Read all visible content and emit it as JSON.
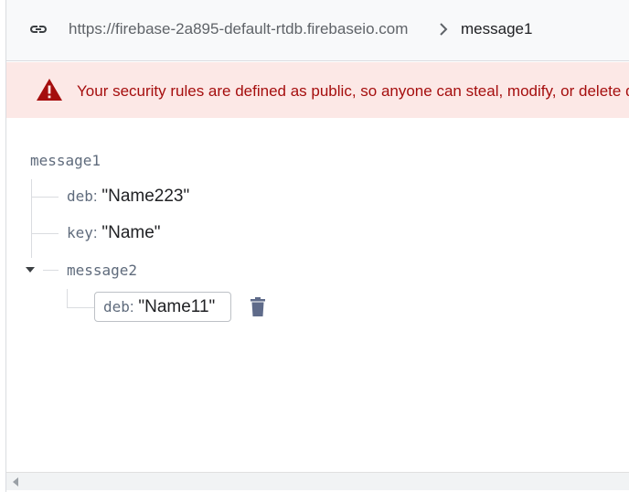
{
  "breadcrumb": {
    "url": "https://firebase-2a895-default-rtdb.firebaseio.com",
    "current": "message1"
  },
  "banner": {
    "text": "Your security rules are defined as public, so anyone can steal, modify, or delete data in your database"
  },
  "tree": {
    "root": "message1",
    "children": [
      {
        "key": "deb",
        "value": "\"Name223\""
      },
      {
        "key": "key",
        "value": "\"Name\""
      }
    ],
    "child_node": {
      "name": "message2",
      "editing": {
        "key": "deb",
        "value": "\"Name11\""
      }
    }
  },
  "colon": ":",
  "colors": {
    "banner_bg": "#fce8e6",
    "warning_red": "#a50e0e",
    "icon_blue": "#5f6b8a"
  },
  "icons": [
    "link-icon",
    "chevron-right-icon",
    "warning-icon",
    "caret-down-icon",
    "trash-icon",
    "scroll-left-arrow-icon"
  ]
}
